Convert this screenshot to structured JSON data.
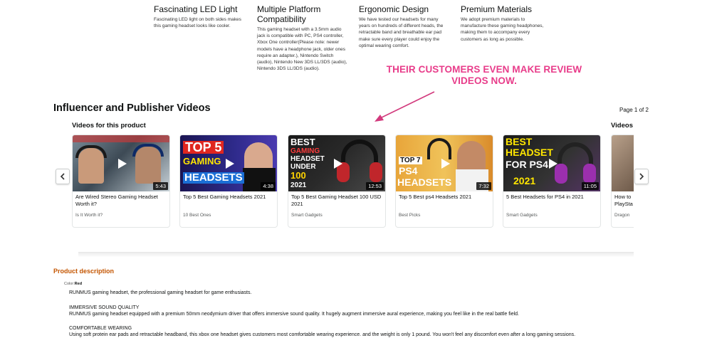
{
  "features": [
    {
      "title": "Fascinating LED Light",
      "text": "Fascinating LED light on both sides makes this gaming headset looks like cooler."
    },
    {
      "title": "Multiple Platform Compatibility",
      "text": "This gaming headset with a 3.5mm audio jack is compatible with PC, PS4 controller, Xbox One controller(Please note: newer models have a headphone jack, older ones require an adapter.), Nintendo Switch (audio), Nintendo New 3DS LL/3DS (audio), Nintendo 3DS LL/3DS (audio)."
    },
    {
      "title": "Ergonomic Design",
      "text": "We have tested our headsets for many years on hundreds of different heads, the retractable band and breathable ear pad make sure every player could enjoy the optimal wearing comfort."
    },
    {
      "title": "Premium Materials",
      "text": "We adopt premium materials to manufacture these gaming headphones, making them to accompany every customers as long as possible."
    }
  ],
  "annotation": {
    "line1": "THEIR CUSTOMERS EVEN MAKE REVIEW",
    "line2": "VIDEOS NOW.",
    "color": "#e83c8a"
  },
  "videos_section": {
    "title": "Influencer and Publisher Videos",
    "page_indicator": "Page 1 of 2",
    "subtitle": "Videos for this product",
    "subtitle_partial": "Videos",
    "prev_icon": "chevron-left-icon",
    "next_icon": "chevron-right-icon",
    "cards": [
      {
        "title": "Are Wired Stereo Gaming Headset Worth it?",
        "author": "Is It Worth it?",
        "duration": "5:43",
        "thumb_text": ""
      },
      {
        "title": "Top 5 Best Gaming Headsets 2021",
        "author": "10 Best Ones",
        "duration": "4:38",
        "thumb_text_1": "TOP 5",
        "thumb_text_2": "GAMING",
        "thumb_text_3": "HEADSETS"
      },
      {
        "title": "Top 5 Best Gaming Headset 100 USD 2021",
        "author": "Smart Gadgets",
        "duration": "12:53",
        "thumb_text_1": "BEST",
        "thumb_text_2": "GAMING",
        "thumb_text_3": "HEADSET",
        "thumb_text_4": "UNDER",
        "thumb_text_5": "100",
        "thumb_text_6": "2021"
      },
      {
        "title": "Top 5 Best ps4 Headsets 2021",
        "author": "Best Picks",
        "duration": "7:32",
        "thumb_text_1": "TOP 7",
        "thumb_text_2": "PS4",
        "thumb_text_3": "HEADSETS"
      },
      {
        "title": "5 Best Headsets for PS4 in 2021",
        "author": "Smart Gadgets",
        "duration": "11:05",
        "thumb_text_1": "BEST",
        "thumb_text_2": "HEADSET",
        "thumb_text_3": "FOR PS4",
        "thumb_text_4": "2021"
      },
      {
        "title": "How to PlaySta",
        "author": "Dragon",
        "duration": ""
      }
    ]
  },
  "product_description": {
    "title": "Product description",
    "color_label": "Color:",
    "color_value": "Red",
    "lines": [
      "RUNMUS gaming headset, the professional gaming headset for game enthusiasts.",
      "IMMERSIVE SOUND QUALITY",
      "RUNMUS gaming headset equipped with a premium 50mm neodymium driver that offers immersive sound quality. It hugely augment immersive aural experience, making you feel like in the real battle field.",
      "COMFORTABLE WEARING",
      "Using soft protein ear pads and retractable headband, this xbox one headset gives customers most comfortable wearing experience. and the weight is only 1 pound. You won't feel any discomfort even after a long gaming sessions."
    ]
  }
}
